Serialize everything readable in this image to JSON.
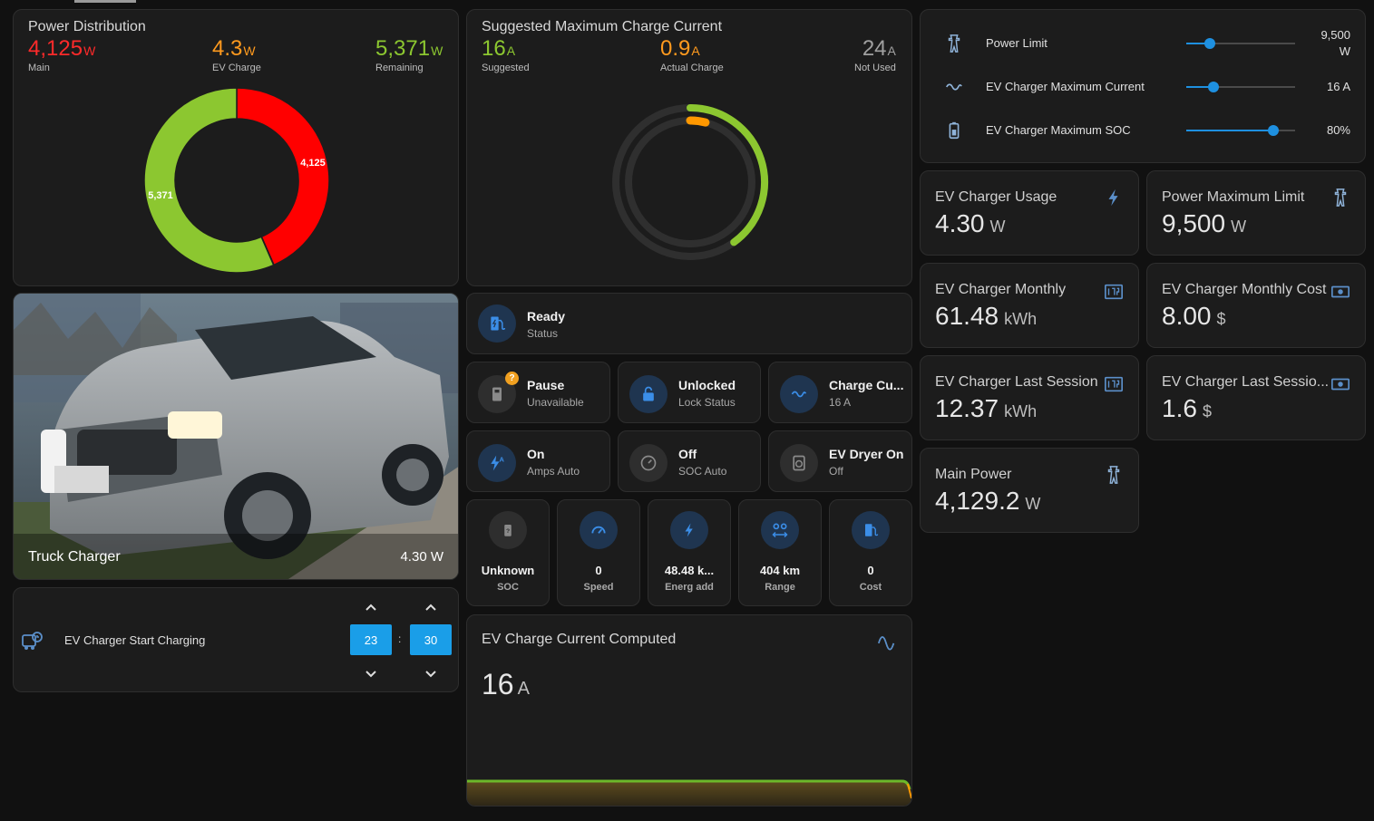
{
  "power_distribution": {
    "title": "Power Distribution",
    "main": {
      "value": "4,125",
      "unit": "W",
      "label": "Main"
    },
    "ev": {
      "value": "4.3",
      "unit": "W",
      "label": "EV Charge"
    },
    "remaining": {
      "value": "5,371",
      "unit": "W",
      "label": "Remaining"
    },
    "donut_labels": {
      "main": "4,125",
      "remaining": "5,371"
    },
    "colors": {
      "main": "#ff0000",
      "remaining": "#8cc730",
      "ev": "#ff9800"
    }
  },
  "chart_data": {
    "type": "pie",
    "categories": [
      "Main",
      "EV Charge",
      "Remaining"
    ],
    "values": [
      4125,
      4.3,
      5371
    ]
  },
  "suggested": {
    "title": "Suggested Maximum Charge Current",
    "suggested": {
      "value": "16",
      "unit": "A",
      "label": "Suggested"
    },
    "actual": {
      "value": "0.9",
      "unit": "A",
      "label": "Actual Charge"
    },
    "not_used": {
      "value": "24",
      "unit": "A",
      "label": "Not Used"
    },
    "gauge": {
      "outer_fraction": 0.4,
      "inner_fraction": 0.04,
      "outer_color": "#8cc730",
      "inner_color": "#ff9800"
    }
  },
  "sliders": [
    {
      "label": "Power Limit",
      "value": "9,500",
      "unit": "W",
      "fraction": 0.22,
      "icon": "transmission-tower-icon"
    },
    {
      "label": "EV Charger Maximum Current",
      "value": "16 A",
      "fraction": 0.25,
      "icon": "current-ac-icon"
    },
    {
      "label": "EV Charger Maximum SOC",
      "value": "80%",
      "fraction": 0.8,
      "icon": "battery-icon"
    }
  ],
  "entities": {
    "usage": {
      "title": "EV Charger Usage",
      "value": "4.30",
      "unit": "W",
      "icon": "flash-icon"
    },
    "power_max": {
      "title": "Power Maximum Limit",
      "value": "9,500",
      "unit": "W",
      "icon": "transmission-tower-icon"
    },
    "monthly": {
      "title": "EV Charger Monthly",
      "value": "61.48",
      "unit": "kWh",
      "icon": "meter-icon"
    },
    "monthly_cost": {
      "title": "EV Charger Monthly Cost",
      "value": "8.00",
      "unit": "$",
      "icon": "cash-icon"
    },
    "last_session": {
      "title": "EV Charger Last Session",
      "value": "12.37",
      "unit": "kWh",
      "icon": "meter-icon"
    },
    "last_session_cost": {
      "title": "EV Charger Last Sessio...",
      "value": "1.6",
      "unit": "$",
      "icon": "cash-icon"
    },
    "main_power": {
      "title": "Main Power",
      "value": "4,129.2",
      "unit": "W",
      "icon": "transmission-tower-icon"
    }
  },
  "picture": {
    "name": "Truck Charger",
    "state": "4.30 W"
  },
  "status": {
    "title": "Ready",
    "sub": "Status"
  },
  "tiles": [
    {
      "title": "Pause",
      "sub": "Unavailable",
      "icon": "pause-icon"
    },
    {
      "title": "Unlocked",
      "sub": "Lock Status",
      "icon": "lock-icon"
    },
    {
      "title": "Charge Cu...",
      "sub": "16 A",
      "icon": "current-ac-icon"
    },
    {
      "title": "On",
      "sub": "Amps Auto",
      "icon": "flash-auto-icon"
    },
    {
      "title": "Off",
      "sub": "SOC Auto",
      "icon": "gauge-icon"
    },
    {
      "title": "EV Dryer On",
      "sub": "Off",
      "icon": "dryer-icon"
    }
  ],
  "stats": [
    {
      "value": "Unknown",
      "label": "SOC",
      "icon": "battery-unknown-icon"
    },
    {
      "value": "0",
      "label": "Speed",
      "icon": "speedometer-icon"
    },
    {
      "value": "48.48 k...",
      "label": "Energ add",
      "icon": "lightning-icon"
    },
    {
      "value": "404 km",
      "label": "Range",
      "icon": "map-marker-distance-icon"
    },
    {
      "value": "0",
      "label": "Cost",
      "icon": "ev-station-icon"
    }
  ],
  "computed": {
    "title": "EV Charge Current Computed",
    "value": "16",
    "unit": "A",
    "icon": "sine-wave-icon"
  },
  "start_charging": {
    "label": "EV Charger Start Charging",
    "hour": "23",
    "minute": "30",
    "sep": ":"
  }
}
